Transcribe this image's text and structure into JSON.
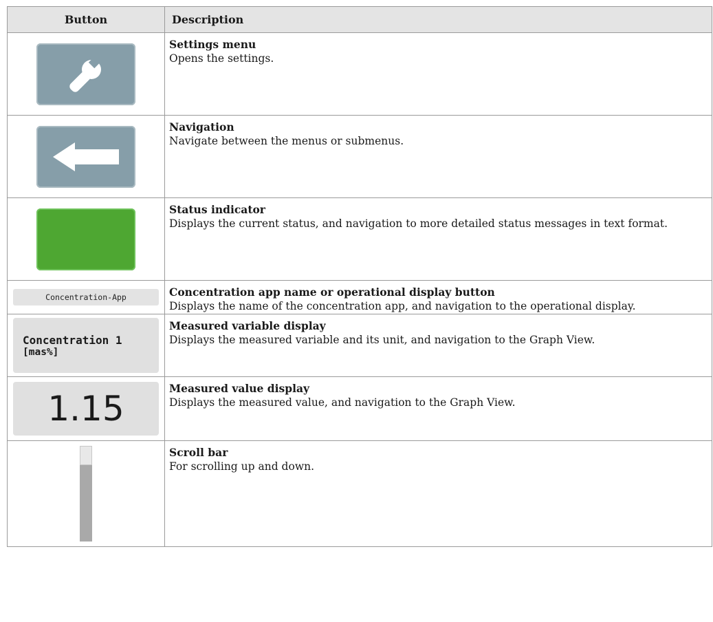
{
  "header": {
    "col_button": "Button",
    "col_description": "Description"
  },
  "rows": [
    {
      "icon": "wrench-icon",
      "title": "Settings menu",
      "text": "Opens the settings."
    },
    {
      "icon": "arrow-left-icon",
      "title": "Navigation",
      "text": "Navigate between the menus or submenus."
    },
    {
      "icon": "status-indicator",
      "color": "#4ea732",
      "title": "Status indicator",
      "text": "Displays the current status, and navigation to more detailed status messages in text format."
    },
    {
      "button_text": "Concentration-App",
      "title": "Concentration app name or operational display button",
      "text": "Displays the name of the concentration app, and navigation to the operational display."
    },
    {
      "button_line1": "Concentration 1",
      "button_line2": "[mas%]",
      "title": "Measured variable display",
      "text": "Displays the measured variable and its unit, and navigation to the Graph View."
    },
    {
      "button_text": "1.15",
      "title": "Measured value display",
      "text": "Displays the measured value, and navigation to the Graph View."
    },
    {
      "icon": "scroll-bar",
      "title": "Scroll bar",
      "text": "For scrolling up and down."
    }
  ]
}
